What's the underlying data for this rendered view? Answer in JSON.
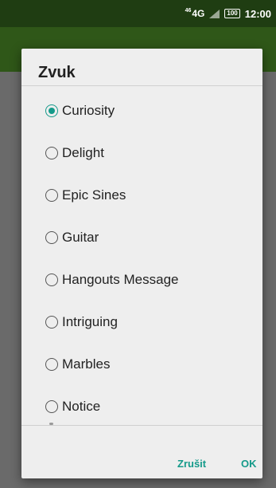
{
  "status_bar": {
    "network_prefix": "46",
    "network": "4G",
    "battery": "100",
    "time": "12:00"
  },
  "dialog": {
    "title": "Zvuk",
    "options": [
      {
        "label": "Curiosity",
        "selected": true
      },
      {
        "label": "Delight",
        "selected": false
      },
      {
        "label": "Epic Sines",
        "selected": false
      },
      {
        "label": "Guitar",
        "selected": false
      },
      {
        "label": "Hangouts Message",
        "selected": false
      },
      {
        "label": "Intriguing",
        "selected": false
      },
      {
        "label": "Marbles",
        "selected": false
      },
      {
        "label": "Notice",
        "selected": false
      }
    ],
    "cancel_label": "Zrušit",
    "ok_label": "OK"
  },
  "colors": {
    "accent": "#159a8a",
    "status_bar": "#1f3d12",
    "app_bar": "#2f5718",
    "scrim": "#6a6a6a",
    "dialog_bg": "#eeeeee"
  },
  "icons": [
    "signal-icon",
    "battery-icon",
    "radio-button-checked-icon",
    "radio-button-unchecked-icon"
  ]
}
